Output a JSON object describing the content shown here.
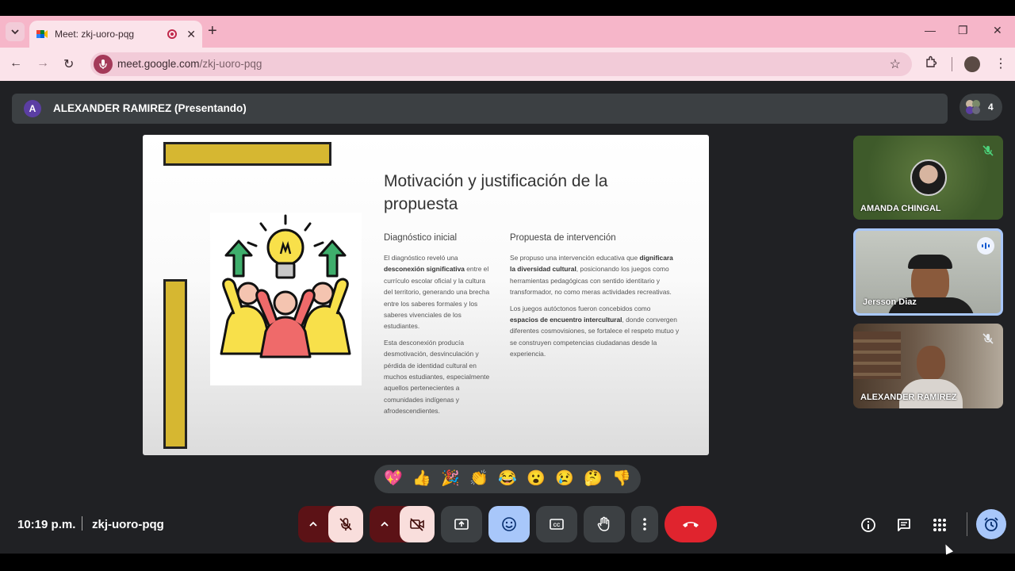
{
  "browser": {
    "tab_title": "Meet: zkj-uoro-pqg",
    "url_host": "meet.google.com",
    "url_path": "/zkj-uoro-pqg",
    "new_tab": "+",
    "close": "✕"
  },
  "presenter": {
    "initial": "A",
    "label": "ALEXANDER RAMIREZ (Presentando)"
  },
  "participant_count": "4",
  "slide": {
    "title": "Motivación y justificación de la propuesta",
    "left_col": {
      "heading": "Diagnóstico inicial",
      "p1_a": "El diagnóstico reveló una ",
      "p1_b": "desconexión significativa",
      "p1_c": " entre el currículo escolar oficial y la cultura del territorio, generando una brecha entre los saberes formales y los saberes vivenciales de los estudiantes.",
      "p2": "Esta desconexión producía desmotivación, desvinculación y pérdida de identidad cultural en muchos estudiantes, especialmente aquellos pertenecientes a comunidades indígenas y afrodescendientes."
    },
    "right_col": {
      "heading": "Propuesta de intervención",
      "p1_a": "Se propuso una intervención educativa que ",
      "p1_b": "dignificara la diversidad cultural",
      "p1_c": ", posicionando los juegos como herramientas pedagógicas con sentido identitario y transformador, no como meras actividades recreativas.",
      "p2_a": "Los juegos autóctonos fueron concebidos como ",
      "p2_b": "espacios de encuentro intercultural",
      "p2_c": ", donde convergen diferentes cosmovisiones, se fortalece el respeto mutuo y se construyen competencias ciudadanas desde la experiencia."
    }
  },
  "participants": [
    {
      "name": "AMANDA CHINGAL"
    },
    {
      "name": "Jersson Diaz"
    },
    {
      "name": "ALEXANDER RAMIREZ"
    }
  ],
  "reactions": [
    "💖",
    "👍",
    "🎉",
    "👏",
    "😂",
    "😮",
    "😢",
    "🤔",
    "👎"
  ],
  "footer": {
    "time": "10:19 p.m.",
    "meeting_code": "zkj-uoro-pqg"
  },
  "colors": {
    "accent_pink": "#f6b6c9",
    "meet_bg": "#202124",
    "end_call": "#e0242e",
    "active_blue": "#a8c7fa",
    "mic_off_bg": "#f9dedc"
  }
}
